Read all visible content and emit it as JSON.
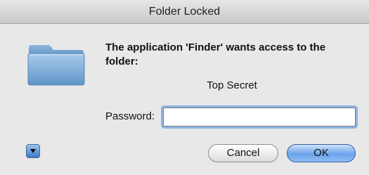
{
  "window": {
    "title": "Folder Locked"
  },
  "dialog": {
    "message": "The application 'Finder' wants access to the folder:",
    "folder_name": "Top Secret",
    "password_label": "Password:",
    "password_value": ""
  },
  "buttons": {
    "cancel": "Cancel",
    "ok": "OK"
  },
  "icons": {
    "folder": "folder-icon",
    "disclosure": "disclosure-triangle-icon"
  },
  "colors": {
    "accent": "#6aa3ea",
    "focus_ring": "#8fb4e3"
  }
}
